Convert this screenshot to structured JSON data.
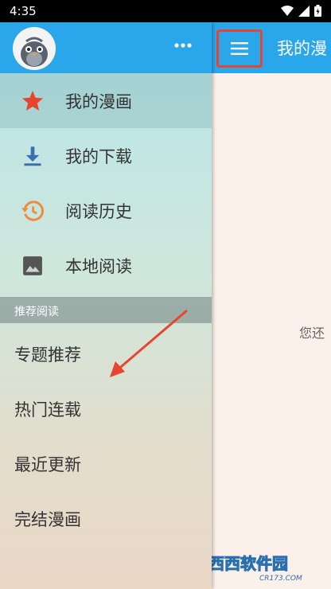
{
  "status_bar": {
    "time": "4:35"
  },
  "main": {
    "title": "我的漫",
    "empty_text": "您还"
  },
  "drawer": {
    "items": [
      {
        "label": "我的漫画",
        "icon": "star-icon"
      },
      {
        "label": "我的下载",
        "icon": "download-icon"
      },
      {
        "label": "阅读历史",
        "icon": "history-icon"
      },
      {
        "label": "本地阅读",
        "icon": "image-icon"
      }
    ],
    "section_title": "推荐阅读",
    "recommend": [
      {
        "label": "专题推荐"
      },
      {
        "label": "热门连载"
      },
      {
        "label": "最近更新"
      },
      {
        "label": "完结漫画"
      }
    ]
  },
  "watermark": {
    "brand": "西西软件园",
    "domain": "CR173.COM"
  },
  "colors": {
    "accent": "#2aa7ea",
    "highlight_box": "#e8452f",
    "star": "#e8452f",
    "download": "#3b6fb0",
    "history": "#f08a3c",
    "image": "#555555"
  }
}
